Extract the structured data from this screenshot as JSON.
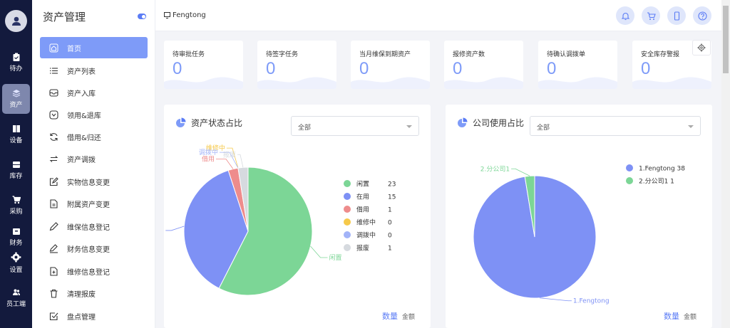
{
  "rail": {
    "items": [
      {
        "label": "待办",
        "icon": "clipboard-icon"
      },
      {
        "label": "资产",
        "icon": "layers-icon"
      },
      {
        "label": "设备",
        "icon": "book-icon"
      },
      {
        "label": "库存",
        "icon": "inbox-icon"
      },
      {
        "label": "采购",
        "icon": "cart-icon"
      },
      {
        "label": "财务",
        "icon": "box-icon"
      },
      {
        "label": "设置",
        "icon": "gear-icon"
      },
      {
        "label": "员工端",
        "icon": "users-icon"
      }
    ]
  },
  "menu": {
    "title": "资产管理",
    "items": [
      {
        "label": "首页",
        "icon": "home-icon"
      },
      {
        "label": "资产列表",
        "icon": "list-icon"
      },
      {
        "label": "资产入库",
        "icon": "inbox-in-icon"
      },
      {
        "label": "领用&退库",
        "icon": "chevron-circle-icon"
      },
      {
        "label": "借用&归还",
        "icon": "refresh-icon"
      },
      {
        "label": "资产调拨",
        "icon": "transfer-icon"
      },
      {
        "label": "实物信息变更",
        "icon": "edit-icon"
      },
      {
        "label": "附属资产变更",
        "icon": "file-icon"
      },
      {
        "label": "维保信息登记",
        "icon": "pen-icon"
      },
      {
        "label": "财务信息变更",
        "icon": "pen-line-icon"
      },
      {
        "label": "维修信息登记",
        "icon": "file-plus-icon"
      },
      {
        "label": "清理报废",
        "icon": "trash-icon"
      },
      {
        "label": "盘点管理",
        "icon": "check-square-icon"
      }
    ]
  },
  "topbar": {
    "company": "Fengtong"
  },
  "cards": [
    {
      "title": "待审批任务",
      "value": "0"
    },
    {
      "title": "待签字任务",
      "value": "0"
    },
    {
      "title": "当月维保到期资产",
      "value": "0"
    },
    {
      "title": "报修资产数",
      "value": "0"
    },
    {
      "title": "待确认调拨单",
      "value": "0"
    },
    {
      "title": "安全库存警报",
      "value": "0"
    }
  ],
  "status_panel": {
    "title": "资产状态占比",
    "select": "全部",
    "foot_active": "数量",
    "foot_other": "金额",
    "colors": [
      "#7cd696",
      "#7e91f5",
      "#ee8c8c",
      "#f6c94a",
      "#a2b3f8",
      "#d6dadf"
    ]
  },
  "company_panel": {
    "title": "公司使用占比",
    "select": "全部",
    "foot_active": "数量",
    "foot_other": "金额",
    "colors": [
      "#7e91f5",
      "#7cd696"
    ]
  },
  "chart_data": [
    {
      "type": "pie",
      "title": "资产状态占比",
      "categories": [
        "闲置",
        "在用",
        "借用",
        "维修中",
        "调拨中",
        "报废"
      ],
      "values": [
        23,
        15,
        1,
        0,
        0,
        1
      ]
    },
    {
      "type": "pie",
      "title": "公司使用占比",
      "categories": [
        "1.Fengtong",
        "2.分公司1"
      ],
      "values": [
        38,
        1
      ]
    }
  ]
}
